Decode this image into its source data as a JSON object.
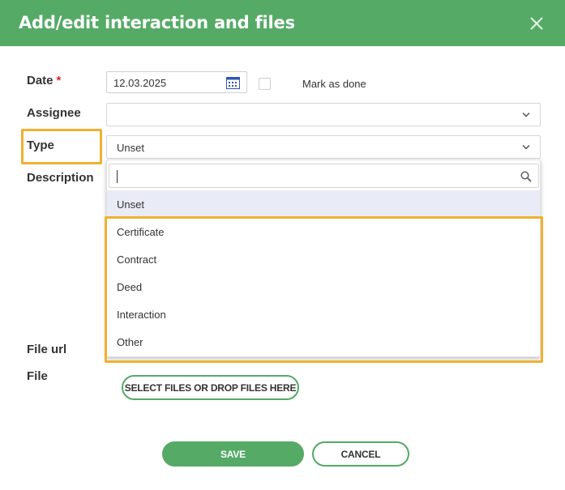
{
  "dialog": {
    "title": "Add/edit interaction and files"
  },
  "form": {
    "date_label": "Date",
    "required_mark": "*",
    "date_value": "12.03.2025",
    "mark_done_label": "Mark as done",
    "assignee_label": "Assignee",
    "assignee_value": "",
    "type_label": "Type",
    "type_value": "Unset",
    "description_label": "Description",
    "file_url_label": "File url",
    "file_label": "File",
    "select_files_label": "SELECT FILES OR DROP FILES HERE"
  },
  "type_dropdown": {
    "search_value": "",
    "options": [
      "Unset",
      "Certificate",
      "Contract",
      "Deed",
      "Interaction",
      "Other"
    ],
    "selected": "Unset"
  },
  "actions": {
    "save_label": "SAVE",
    "cancel_label": "CANCEL"
  },
  "colors": {
    "brand": "#55aa66",
    "highlight": "#f0b030",
    "required": "#e0242e",
    "selected_option_bg": "#e9ecf7"
  },
  "icons": [
    "close-icon",
    "calendar-icon",
    "chevron-down-icon",
    "search-icon"
  ]
}
